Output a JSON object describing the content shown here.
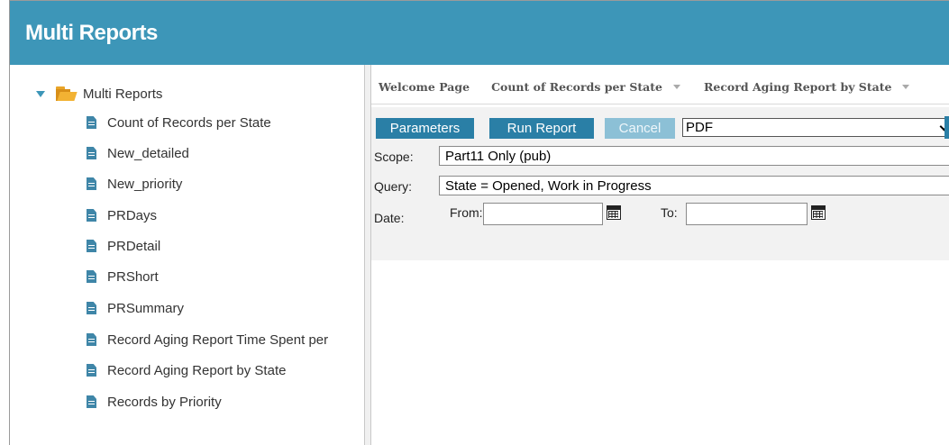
{
  "app": {
    "title": "Multi Reports"
  },
  "tree": {
    "root_label": "Multi Reports",
    "items": [
      {
        "label": "Count of Records per State"
      },
      {
        "label": "New_detailed"
      },
      {
        "label": "New_priority"
      },
      {
        "label": "PRDays"
      },
      {
        "label": "PRDetail"
      },
      {
        "label": "PRShort"
      },
      {
        "label": "PRSummary"
      },
      {
        "label": "Record Aging Report Time Spent per"
      },
      {
        "label": "Record Aging Report by State"
      },
      {
        "label": "Records by Priority"
      }
    ]
  },
  "tabs": [
    {
      "label": "Welcome Page"
    },
    {
      "label": "Count of Records per State"
    },
    {
      "label": "Record Aging Report by State"
    }
  ],
  "toolbar": {
    "parameters_label": "Parameters",
    "run_report_label": "Run Report",
    "cancel_label": "Cancel",
    "format_value": "PDF"
  },
  "params": {
    "scope_label": "Scope:",
    "scope_value": "Part11 Only (pub)",
    "query_label": "Query:",
    "query_value": "State = Opened, Work in Progress",
    "date_label": "Date:",
    "from_label": "From:",
    "from_value": "",
    "to_label": "To:",
    "to_value": ""
  },
  "colors": {
    "header_bg": "#3d96b8",
    "button_bg": "#2a7fa6",
    "button_disabled_bg": "#8cc0d6",
    "folder": "#f2b233",
    "doc_icon": "#3f86a8"
  },
  "icons": {
    "tree_toggle": "caret-down-icon",
    "root": "folder-open-icon",
    "item": "document-icon",
    "date_picker": "calendar-icon",
    "tab_menu": "chevron-down-icon"
  }
}
